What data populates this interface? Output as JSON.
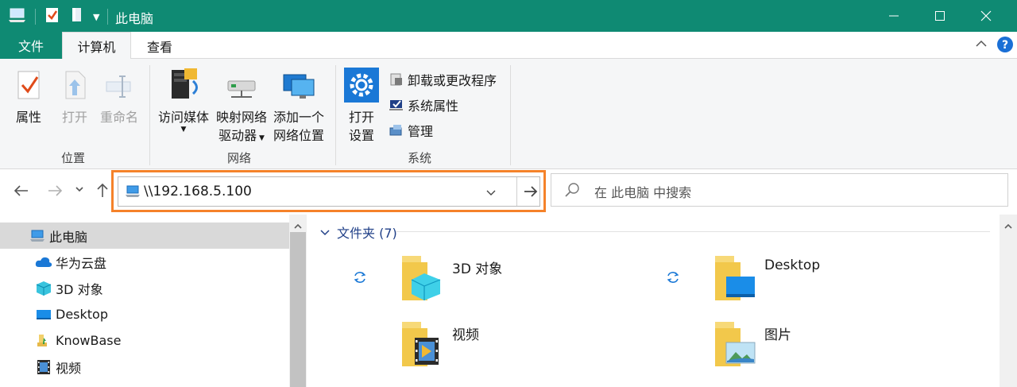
{
  "window": {
    "title": "此电脑",
    "accent": "#0f8a73",
    "controls": [
      "minimize-icon",
      "maximize-icon",
      "close-icon"
    ]
  },
  "ribbon_tabs": {
    "file": "文件",
    "computer": "计算机",
    "view": "查看"
  },
  "ribbon": {
    "location_group": {
      "label": "位置",
      "properties": "属性",
      "open": "打开",
      "rename": "重命名"
    },
    "network_group": {
      "label": "网络",
      "access_media": "访问媒体",
      "map_drive_line1": "映射网络",
      "map_drive_line2": "驱动器",
      "add_location_line1": "添加一个",
      "add_location_line2": "网络位置"
    },
    "system_group": {
      "label": "系统",
      "open_settings_line1": "打开",
      "open_settings_line2": "设置",
      "uninstall": "卸载或更改程序",
      "system_properties": "系统属性",
      "manage": "管理"
    }
  },
  "address_bar": {
    "value": "\\\\192.168.5.100",
    "highlight": "#f5822a"
  },
  "search": {
    "placeholder": "在 此电脑 中搜索"
  },
  "sidebar": {
    "items": [
      {
        "label": "此电脑",
        "icon": "computer-icon"
      },
      {
        "label": "华为云盘",
        "icon": "cloud-icon"
      },
      {
        "label": "3D 对象",
        "icon": "cube-icon"
      },
      {
        "label": "Desktop",
        "icon": "desktop-icon"
      },
      {
        "label": "KnowBase",
        "icon": "folder-download-icon"
      },
      {
        "label": "视频",
        "icon": "film-icon"
      }
    ]
  },
  "content": {
    "section_title": "文件夹 (7)",
    "folders": [
      {
        "name": "3D 对象"
      },
      {
        "name": "Desktop"
      },
      {
        "name": "视频"
      },
      {
        "name": "图片"
      }
    ]
  }
}
